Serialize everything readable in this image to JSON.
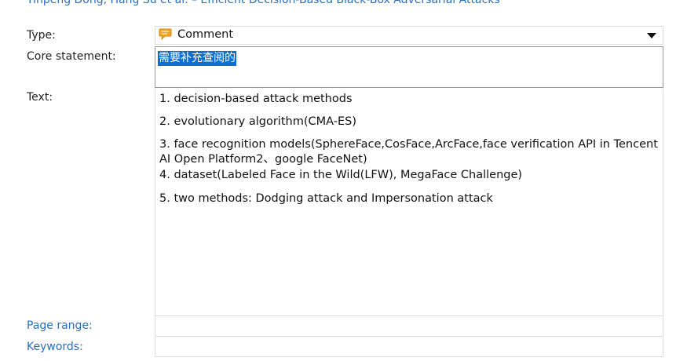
{
  "header": {
    "reference": "Yinpeng Dong, Hang Su et al. – Efficient Decision-Based Black-Box Adversarial Attacks"
  },
  "labels": {
    "type": "Type:",
    "core_statement": "Core statement:",
    "text": "Text:",
    "page_range": "Page range:",
    "keywords": "Keywords:"
  },
  "type_field": {
    "value": "Comment",
    "icon": "comment-bubble-icon"
  },
  "core_statement": {
    "value": "需要补充查阅的"
  },
  "text_field": {
    "lines": [
      "1. decision-based attack methods",
      "2. evolutionary algorithm(CMA-ES)",
      "3. face recognition models(SphereFace,CosFace,ArcFace,face verification API in Tencent AI Open Platform2、google FaceNet)",
      "4. dataset(Labeled Face in the Wild(LFW), MegaFace Challenge)",
      "5. two methods: Dodging attack and Impersonation attack"
    ]
  },
  "page_range": {
    "value": ""
  },
  "keywords": {
    "value": ""
  },
  "colors": {
    "link": "#2a6ebb",
    "selection": "#0a6fd0",
    "icon_fill": "#f5a623"
  }
}
